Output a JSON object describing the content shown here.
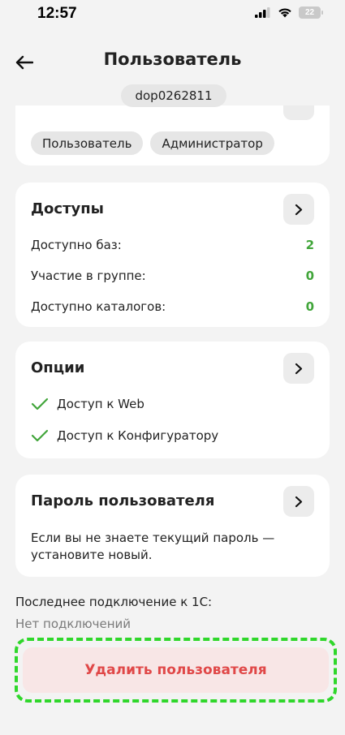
{
  "status": {
    "time": "12:57",
    "battery": "22"
  },
  "header": {
    "title": "Пользователь",
    "login": "dop0262811"
  },
  "roles": [
    "Пользователь",
    "Администратор"
  ],
  "access": {
    "title": "Доступы",
    "rows": [
      {
        "label": "Доступно баз:",
        "value": "2"
      },
      {
        "label": "Участие в группе:",
        "value": "0"
      },
      {
        "label": "Доступно каталогов:",
        "value": "0"
      }
    ]
  },
  "options": {
    "title": "Опции",
    "items": [
      "Доступ к Web",
      "Доступ к Конфигуратору"
    ]
  },
  "password": {
    "title": "Пароль пользователя",
    "hint": "Если вы не знаете текущий пароль — установите новый."
  },
  "last_connection": {
    "label": "Последнее подключение к 1С:",
    "value": "Нет подключений"
  },
  "delete_label": "Удалить пользователя",
  "colors": {
    "accent_green": "#41a53a",
    "danger": "#e04848",
    "danger_bg": "#f8e6e6",
    "highlight": "#2fd72b"
  }
}
